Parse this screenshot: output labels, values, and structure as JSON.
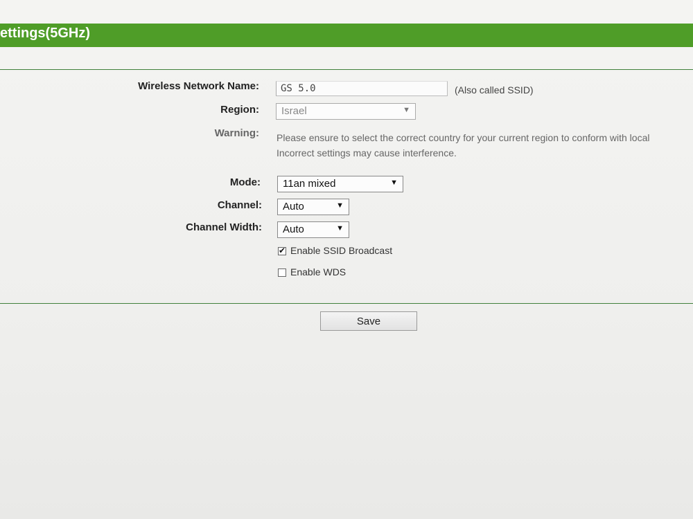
{
  "header": {
    "title": "ettings(5GHz)"
  },
  "form": {
    "network_name_label": "Wireless Network Name:",
    "network_name_value": "GS 5.0",
    "ssid_note": "(Also called SSID)",
    "region_label": "Region:",
    "region_value": "Israel",
    "warning_label": "Warning:",
    "warning_line1": "Please ensure to select the correct country for your current region to conform with local",
    "warning_line2": "Incorrect settings may cause interference.",
    "mode_label": "Mode:",
    "mode_value": "11an mixed",
    "channel_label": "Channel:",
    "channel_value": "Auto",
    "channel_width_label": "Channel Width:",
    "channel_width_value": "Auto",
    "ssid_broadcast_label": "Enable SSID Broadcast",
    "ssid_broadcast_checked": true,
    "wds_label": "Enable WDS",
    "wds_checked": false
  },
  "actions": {
    "save_label": "Save"
  },
  "icons": {
    "dropdown": "dropdown-arrow-icon",
    "checkmark": "checkmark-icon"
  },
  "colors": {
    "header_green": "#4f9d28",
    "rule_green": "#3f7f3a"
  }
}
